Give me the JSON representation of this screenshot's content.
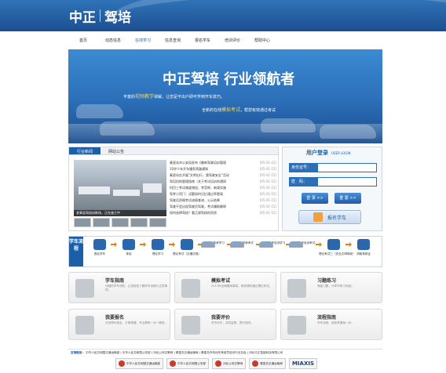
{
  "header": {
    "logo_a": "中正",
    "logo_b": "驾培"
  },
  "nav": [
    "首页",
    "动态信息",
    "在线学习",
    "信息查询",
    "报名学车",
    "培训评价",
    "帮助中心"
  ],
  "nav_active_index": 2,
  "banner": {
    "title": "中正驾培 行业领航者",
    "sub1_pre": "丰富的",
    "sub1_hl": "视频教学",
    "sub1_post": "讲解，让您足不出户即可学到开车技巧。",
    "sub2_pre": "全新的在线",
    "sub2_hl": "模拟考试",
    "sub2_post": "，帮您有效通过考试"
  },
  "news": {
    "tabs": [
      "行业新闻",
      "网站公告"
    ],
    "photo_caption": "宜章县驾校训练场，正在施工中",
    "items": [
      {
        "t": "秦皇岛市公安局发布《最新驾驶培训管理",
        "d": "[05-01-15]"
      },
      {
        "t": "10岁少年开车撞死两路通知",
        "d": "[05-01-15]"
      },
      {
        "t": "秦皇岛在开展\"文明出行，我驾驶安全\"活动",
        "d": "[05-01-15]"
      },
      {
        "t": "驾培机构管理指南（关于考试培训的通知",
        "d": "[05-01-15]"
      },
      {
        "t": "科目三考试难度增加，考官称，新规实施",
        "d": "[05-01-15]"
      },
      {
        "t": "驾考小窍门：试题如何记忆通过率更高",
        "d": "[05-01-15]"
      },
      {
        "t": "驾驶员资格考试成绩查询，公示结果",
        "d": "[05-01-15]"
      },
      {
        "t": "驾驶不会出现驾驶员驾驶，考试辅助解释",
        "d": "[05-01-15]"
      },
      {
        "t": "如何选择驾校？看正规驾校的资质",
        "d": "[05-01-15]"
      }
    ]
  },
  "login": {
    "title": "用户登录",
    "title_en": "USER LOGIN",
    "user_label": "身份证号：",
    "pass_label": "密　码：",
    "login_btn": "登 录 >>",
    "reset_btn": "重 置 >>",
    "register_btn": "报名学车"
  },
  "flow": {
    "label": "学车流程",
    "steps": [
      "报名学车",
      "体检",
      "理论学习",
      "理论考试（交通法规）",
      "场内驾驶学习",
      "场内驾驶考试",
      "道路驾驶培训学习",
      "道路驾驶培训考试",
      "理论考试三（安全文明驾驶）",
      "领取驾驶证"
    ]
  },
  "cards": [
    {
      "title": "学车指南",
      "desc": "详细的学车须知，让您轻松了解学车流程与注意事项。"
    },
    {
      "title": "模拟考试",
      "desc": "2013年全新题库模拟，助您顺利通过理论考试。"
    },
    {
      "title": "习题练习",
      "desc": "海量习题，分章节练习巩固。"
    },
    {
      "title": "我要报名",
      "desc": "在线预约报名，方便快捷，专业教练一对一服务。"
    },
    {
      "title": "我要评价",
      "desc": "学员评价，共同监督，提升服务。"
    },
    {
      "title": "流程指南",
      "desc": "学车流程，轻松掌握每一步。"
    }
  ],
  "footer": {
    "label": "友情链接：",
    "links": [
      "中华人民共和国交通运输部",
      "中华人民共和国公安部",
      "河北公安交警网",
      "秦皇岛交通运输局",
      "秦皇岛市机动车驾驶员培训行业协会",
      "河北中正智能科技有限公司"
    ],
    "logos": [
      "中华人民共和国交通运输部",
      "中华人民共和国公安部",
      "河北公安交警网",
      "秦皇岛交通运输局",
      "MIAXIS"
    ]
  },
  "colors": {
    "primary": "#1c5fa8",
    "accent": "#e08020",
    "highlight": "#ffd24a"
  }
}
